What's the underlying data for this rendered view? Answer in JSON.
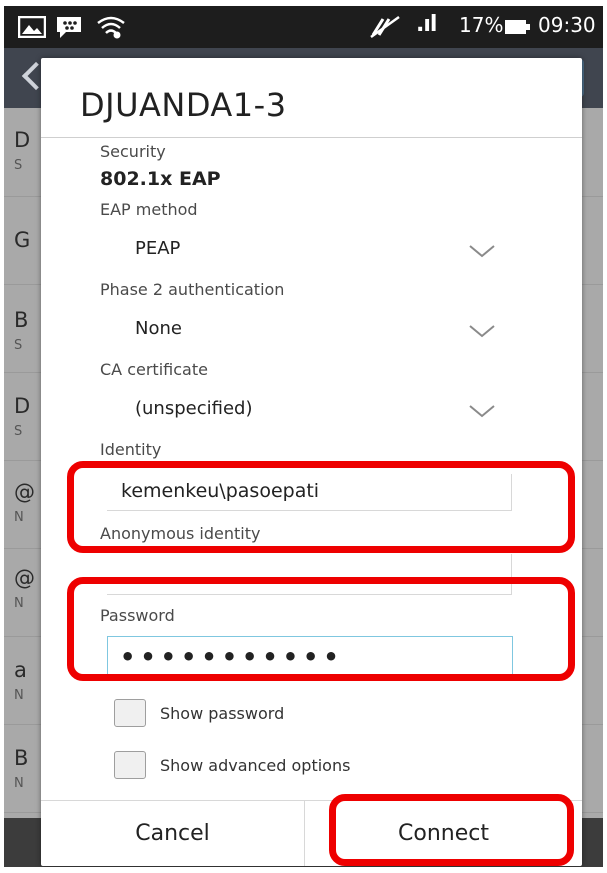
{
  "status_bar": {
    "signal_text": ".ıl",
    "battery_text": "17%",
    "time": "09:30"
  },
  "background_list": {
    "rows": [
      {
        "title": "D",
        "sub": "S"
      },
      {
        "title": "G",
        "sub": ""
      },
      {
        "title": "B",
        "sub": "S"
      },
      {
        "title": "D",
        "sub": "S"
      },
      {
        "title": "@",
        "sub": "N"
      },
      {
        "title": "@",
        "sub": "N"
      },
      {
        "title": "a",
        "sub": "N"
      },
      {
        "title": "B",
        "sub": "N"
      }
    ]
  },
  "dialog": {
    "title": "DJUANDA1-3",
    "security_label": "Security",
    "security_value": "802.1x EAP",
    "eap_method_label": "EAP method",
    "eap_method_value": "PEAP",
    "phase2_label": "Phase 2 authentication",
    "phase2_value": "None",
    "ca_cert_label": "CA certificate",
    "ca_cert_value": "(unspecified)",
    "identity_label": "Identity",
    "identity_value": "kemenkeu\\pasoepati",
    "anon_identity_label": "Anonymous identity",
    "anon_identity_value": "",
    "password_label": "Password",
    "password_value": "•••••••••••",
    "show_password_label": "Show password",
    "show_password_checked": false,
    "show_advanced_label": "Show advanced options",
    "show_advanced_checked": false,
    "cancel_label": "Cancel",
    "connect_label": "Connect"
  },
  "colors": {
    "annotation_red": "#ee0000",
    "password_focus": "#7fc7e0",
    "status_bar_bg": "#1d1d1d",
    "app_bar_bg": "#40454f"
  }
}
